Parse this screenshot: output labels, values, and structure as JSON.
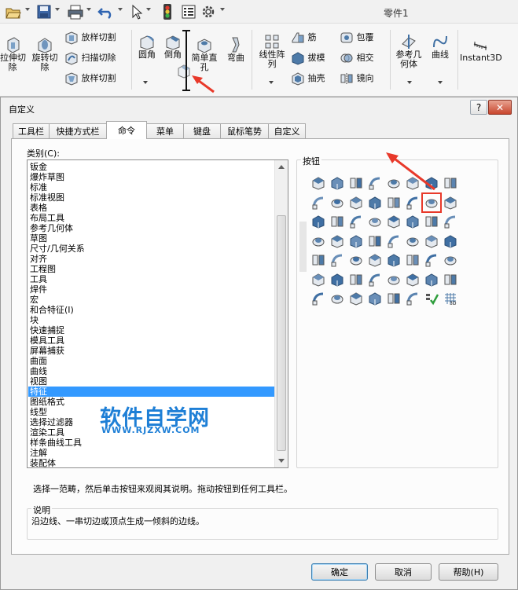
{
  "window": {
    "title": "零件1"
  },
  "ribbon": {
    "loft_cut_left": "放样切割",
    "extrude_cut": "拉伸切\n除",
    "revolve_cut": "旋转切\n除",
    "loft_cut": "放样切割",
    "sweep_cut": "扫描切除",
    "boundary_cut": "放样切割",
    "fillet": "圆角",
    "chamfer": "倒角",
    "simple_hole": "简单直\n孔",
    "flex": "弯曲",
    "linear_pattern": "线性阵\n列",
    "rib": "筋",
    "draft": "拔模",
    "shell": "抽壳",
    "wrap": "包覆",
    "intersect": "相交",
    "mirror": "镜向",
    "ref_geometry": "参考几\n何体",
    "curves": "曲线",
    "instant3d": "Instant3D"
  },
  "dialog": {
    "title": "自定义",
    "help_btn": "?",
    "close_btn": "✕",
    "tabs": [
      "工具栏",
      "快捷方式栏",
      "命令",
      "菜单",
      "键盘",
      "鼠标笔势",
      "自定义"
    ],
    "active_tab": "命令",
    "category_label": "类别(C):",
    "categories": [
      "钣金",
      "爆炸草图",
      "标准",
      "标准视图",
      "表格",
      "布局工具",
      "参考几何体",
      "草图",
      "尺寸/几何关系",
      "对齐",
      "工程图",
      "工具",
      "焊件",
      "宏",
      "和合特征(I)",
      "块",
      "快速捕捉",
      "模具工具",
      "屏幕捕获",
      "曲面",
      "曲线",
      "视图",
      "特征",
      "图纸格式",
      "线型",
      "选择过滤器",
      "渲染工具",
      "样条曲线工具",
      "注解",
      "装配体"
    ],
    "selected_category": "特征",
    "buttons_label": "按钮",
    "hint": "选择一范畴，然后单击按钮来观阅其说明。拖动按钮到任何工具栏。",
    "description_label": "说明",
    "description": "沿边线、一串切边或顶点生成一倾斜的边线。",
    "ok": "确定",
    "cancel": "取消",
    "help": "帮助(H)"
  },
  "watermark": {
    "main": "软件自学网",
    "sub": "WWW.RJZXW.COM"
  },
  "colors": {
    "accent_selection": "#3399ff",
    "annotation_red": "#e8392a",
    "icon_blue": "#4d7aa8",
    "watermark_blue": "#1e7fd6"
  }
}
